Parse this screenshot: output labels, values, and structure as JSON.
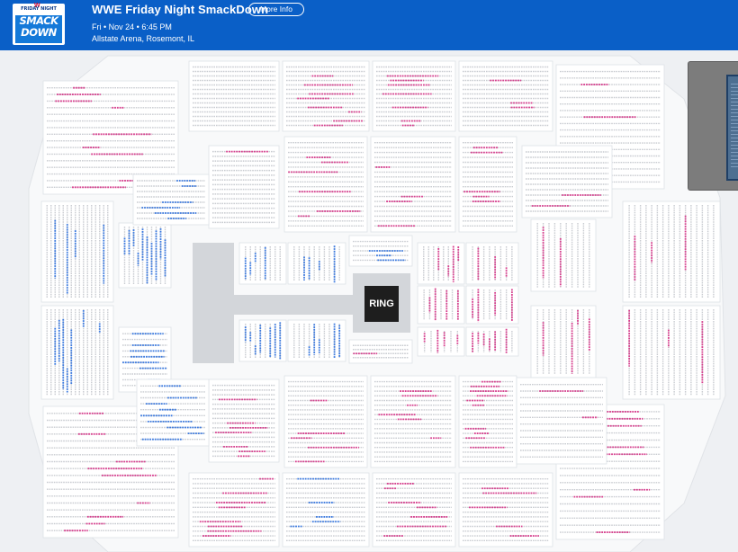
{
  "header": {
    "logo_top_text": "FRIDAY NIGHT",
    "logo_text_1": "SMACK",
    "logo_text_2": "DOWN",
    "event_title": "WWE Friday Night SmackDown",
    "more_info_label": "More Info",
    "date_time": "Fri • Nov 24 • 6:45 PM",
    "venue": "Allstate Arena, Rosemont, IL"
  },
  "map": {
    "stage_label": "RING",
    "legend_colors": {
      "available_standard": "#3d7be0",
      "available_resale": "#d9408f",
      "unavailable": "#c9ccd1",
      "section_fill": "#ffffff",
      "background": "#eef0f3"
    }
  },
  "icons": {
    "logo": "smackdown-logo",
    "minimap": "venue-minimap-thumbnail"
  }
}
